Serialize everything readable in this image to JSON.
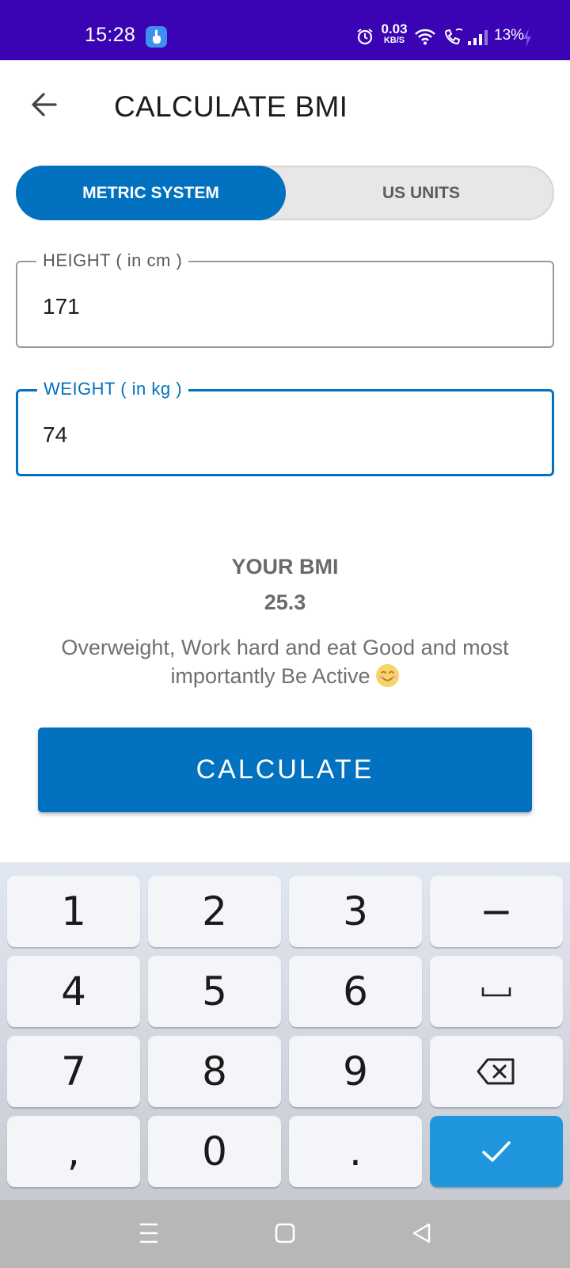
{
  "status_bar": {
    "time": "15:28",
    "net_speed_value": "0.03",
    "net_speed_unit": "KB/S",
    "battery": "13%",
    "icons": [
      "notification-icon",
      "alarm-icon",
      "wifi-icon",
      "wifi-calling-icon",
      "signal-icon",
      "charging-bolt-icon"
    ]
  },
  "app_bar": {
    "title": "CALCULATE BMI",
    "back_icon": "arrow-back-icon"
  },
  "unit_toggle": {
    "options": [
      "METRIC SYSTEM",
      "US UNITS"
    ],
    "selected": "METRIC SYSTEM"
  },
  "height_field": {
    "label": "HEIGHT ( in cm )",
    "value": "171"
  },
  "weight_field": {
    "label": "WEIGHT ( in kg )",
    "value": "74"
  },
  "result": {
    "title": "YOUR BMI",
    "value": "25.3",
    "message": "Overweight, Work hard and eat Good and most importantly Be Active"
  },
  "calculate_button": {
    "label": "CALCULATE"
  },
  "keyboard": {
    "rows": [
      [
        "1",
        "2",
        "3",
        "−"
      ],
      [
        "4",
        "5",
        "6",
        "space"
      ],
      [
        "7",
        "8",
        "9",
        "backspace"
      ],
      [
        ",",
        "0",
        ".",
        "done"
      ]
    ],
    "labels": {
      "k1": "1",
      "k2": "2",
      "k3": "3",
      "minus": "−",
      "k4": "4",
      "k5": "5",
      "k6": "6",
      "k7": "7",
      "k8": "8",
      "k9": "9",
      "comma": ",",
      "k0": "0",
      "dot": "."
    }
  },
  "colors": {
    "status_bar": "#3a04b5",
    "primary": "#0272c0",
    "keyboard_done": "#1f96dd"
  }
}
